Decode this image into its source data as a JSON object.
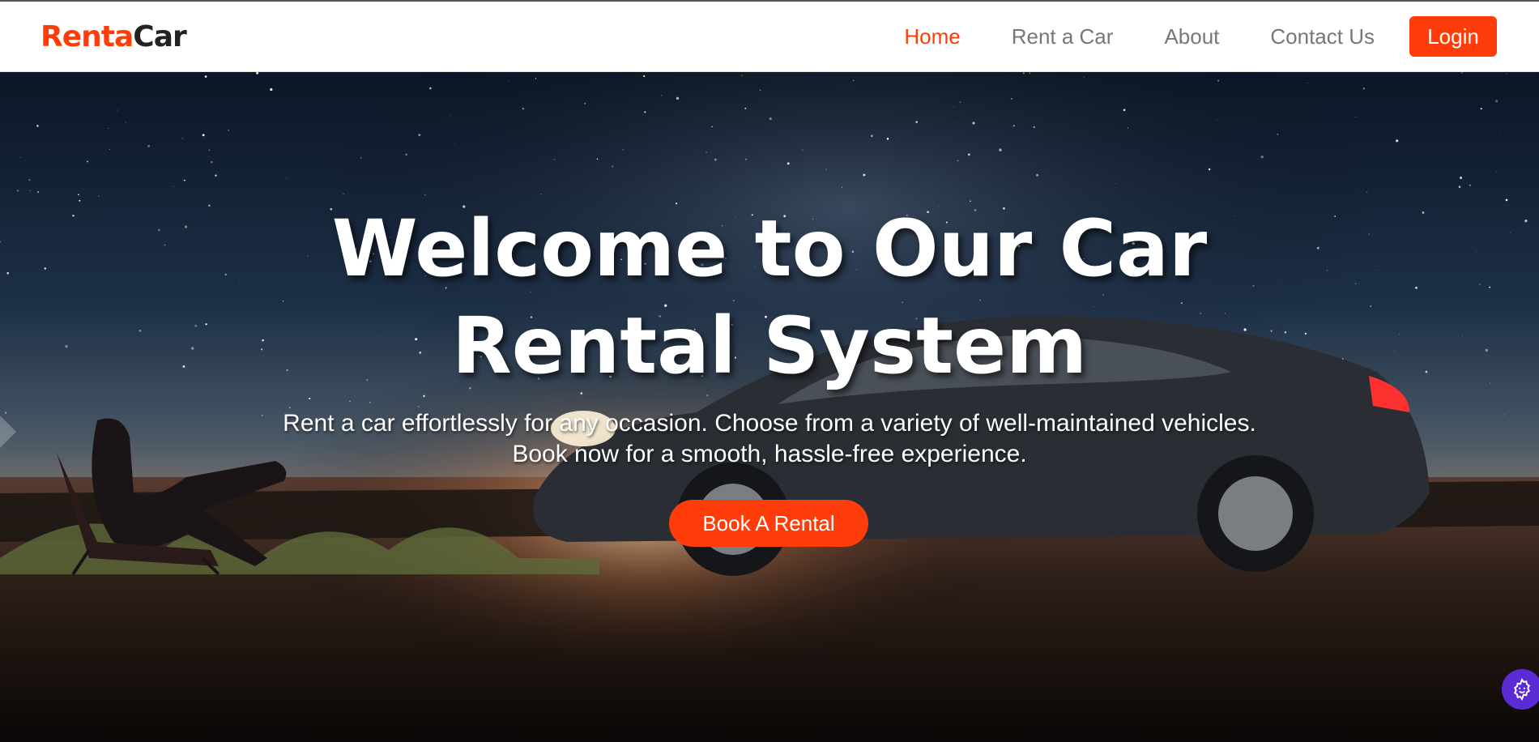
{
  "brand": {
    "part1": "Renta",
    "part2": "Car",
    "accent_color": "#ff3d0a"
  },
  "nav": {
    "items": [
      {
        "label": "Home",
        "active": true
      },
      {
        "label": "Rent a Car",
        "active": false
      },
      {
        "label": "About",
        "active": false
      },
      {
        "label": "Contact Us",
        "active": false
      }
    ],
    "login_label": "Login"
  },
  "hero": {
    "title": "Welcome to Our Car Rental System",
    "subtitle": "Rent a car effortlessly for any occasion. Choose from a variety of well-maintained vehicles. Book now for a smooth, hassle-free experience.",
    "cta_label": "Book A Rental",
    "background": "night sky with car and person in camping chair"
  },
  "widgets": {
    "settings_icon": "gear-icon",
    "settings_color": "#5b2bd6"
  }
}
